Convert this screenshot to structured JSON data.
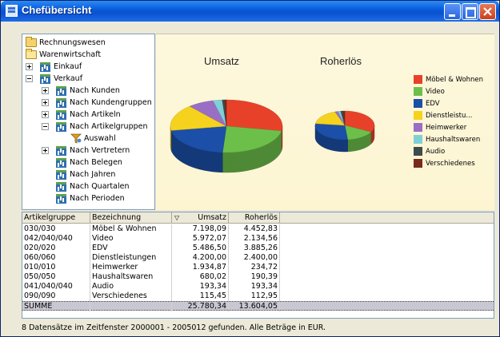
{
  "window": {
    "title": "Chefübersicht"
  },
  "tree": {
    "items": [
      {
        "label": "Rechnungswesen",
        "icon": "folder-icon"
      },
      {
        "label": "Warenwirtschaft",
        "icon": "folder-open-icon"
      },
      {
        "label": "Einkauf",
        "icon": "chart-icon",
        "expander": "plus"
      },
      {
        "label": "Verkauf",
        "icon": "chart-icon",
        "expander": "minus"
      },
      {
        "label": "Nach Kunden",
        "icon": "chart-icon",
        "expander": "plus"
      },
      {
        "label": "Nach Kundengruppen",
        "icon": "chart-icon",
        "expander": "plus"
      },
      {
        "label": "Nach Artikeln",
        "icon": "chart-icon",
        "expander": "plus"
      },
      {
        "label": "Nach Artikelgruppen",
        "icon": "chart-icon",
        "expander": "minus"
      },
      {
        "label": "Auswahl",
        "icon": "filter-icon"
      },
      {
        "label": "Nach Vertretern",
        "icon": "chart-icon",
        "expander": "plus"
      },
      {
        "label": "Nach Belegen",
        "icon": "chart-icon"
      },
      {
        "label": "Nach Jahren",
        "icon": "chart-icon"
      },
      {
        "label": "Nach Quartalen",
        "icon": "chart-icon"
      },
      {
        "label": "Nach Perioden",
        "icon": "chart-icon"
      }
    ]
  },
  "legend": [
    {
      "label": "Möbel & Wohnen",
      "color": "#e8412a"
    },
    {
      "label": "Video",
      "color": "#6cc04a"
    },
    {
      "label": "EDV",
      "color": "#1b4fa8"
    },
    {
      "label": "Dienstleistu...",
      "color": "#f5d21e"
    },
    {
      "label": "Heimwerker",
      "color": "#9a6ec4"
    },
    {
      "label": "Haushaltswaren",
      "color": "#7fd0d4"
    },
    {
      "label": "Audio",
      "color": "#3e4a4c"
    },
    {
      "label": "Verschiedenes",
      "color": "#7a2a1a"
    }
  ],
  "chart_data": [
    {
      "type": "pie",
      "title": "Umsatz",
      "categories": [
        "Möbel & Wohnen",
        "Video",
        "EDV",
        "Dienstleistu...",
        "Heimwerker",
        "Haushaltswaren",
        "Audio",
        "Verschiedenes"
      ],
      "values": [
        7198.09,
        5972.07,
        5486.5,
        4200.0,
        1934.87,
        680.02,
        193.34,
        115.45
      ]
    },
    {
      "type": "pie",
      "title": "Roherlös",
      "categories": [
        "Möbel & Wohnen",
        "Video",
        "EDV",
        "Dienstleistu...",
        "Heimwerker",
        "Haushaltswaren",
        "Audio",
        "Verschiedenes"
      ],
      "values": [
        4452.83,
        2134.56,
        3885.26,
        2400.0,
        234.72,
        190.39,
        193.34,
        112.95
      ]
    }
  ],
  "grid": {
    "columns": [
      "Artikelgruppe",
      "Bezeichnung",
      "Umsatz",
      "Roherlös"
    ],
    "sort_indicator": "▽",
    "rows": [
      [
        "030/030",
        "Möbel & Wohnen",
        "7.198,09",
        "4.452,83"
      ],
      [
        "042/040/040",
        "Video",
        "5.972,07",
        "2.134,56"
      ],
      [
        "020/020",
        "EDV",
        "5.486,50",
        "3.885,26"
      ],
      [
        "060/060",
        "Dienstleistungen",
        "4.200,00",
        "2.400,00"
      ],
      [
        "010/010",
        "Heimwerker",
        "1.934,87",
        "234,72"
      ],
      [
        "050/050",
        "Haushaltswaren",
        "680,02",
        "190,39"
      ],
      [
        "041/040/040",
        "Audio",
        "193,34",
        "193,34"
      ],
      [
        "090/090",
        "Verschiedenes",
        "115,45",
        "112,95"
      ]
    ],
    "summary": [
      "SUMME",
      "",
      "25.780,34",
      "13.604,05"
    ]
  },
  "status": {
    "text": "8 Datensätze im Zeitfenster 2000001 - 2005012 gefunden. Alle Beträge in EUR."
  }
}
